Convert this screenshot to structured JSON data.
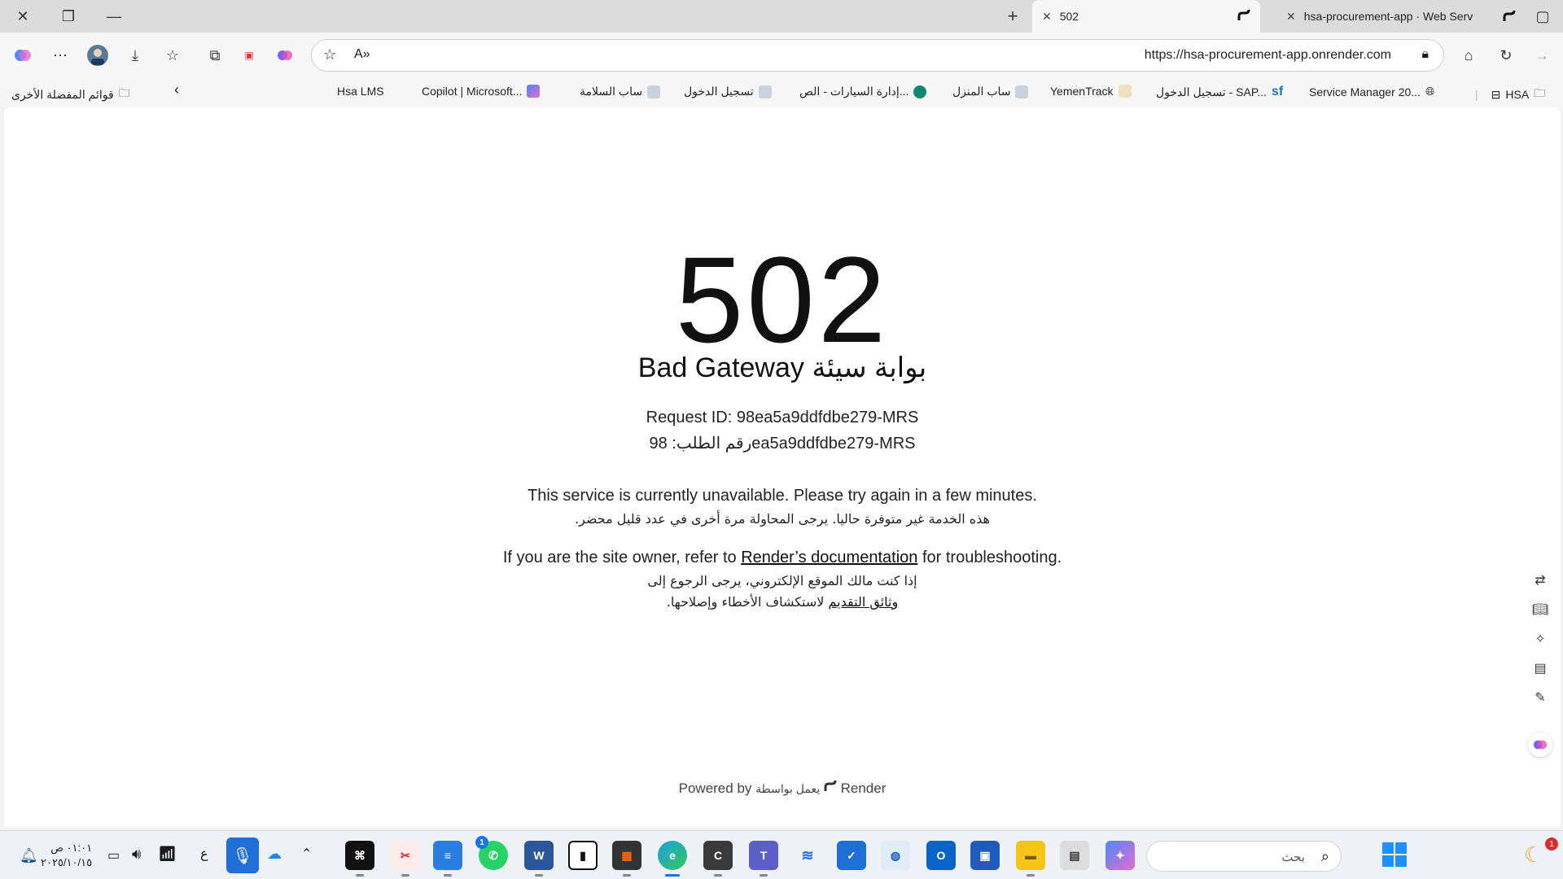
{
  "browser": {
    "tabs": [
      {
        "title": "502",
        "active": true
      },
      {
        "title": "hsa-procurement-app · Web Serv",
        "active": false
      }
    ],
    "new_tab_glyph": "+",
    "url": "https://hsa-procurement-app.onrender.com"
  },
  "bookmarks": {
    "items": [
      {
        "label": "HSA"
      },
      {
        "label": "Service Manager 20..."
      },
      {
        "label": "تسجيل الدخول - SAP..."
      },
      {
        "label": "YemenTrack"
      },
      {
        "label": "ساب المنزل"
      },
      {
        "label": "إدارة السيارات - الص..."
      },
      {
        "label": "تسجيل الدخول"
      },
      {
        "label": "ساب السلامة"
      },
      {
        "label": "Copilot | Microsoft..."
      },
      {
        "label": "Hsa LMS"
      }
    ],
    "other_favorites": "قوائم المفضلة الأخرى"
  },
  "error_page": {
    "code": "502",
    "title_en": "Bad Gateway",
    "title_ar": "بوابة سيئة",
    "request_id_en": "Request ID: 98ea5a9ddfdbe279-MRS",
    "request_id_ar": "رقم الطلب: 98ea5a9ddfdbe279-MRS",
    "unavailable_en": "This service is currently unavailable. Please try again in a few minutes.",
    "unavailable_ar": "هذه الخدمة غير متوفرة حاليا. يرجى المحاولة مرة أخرى في عدد قليل محضر.",
    "owner_en_before": "If you are the site owner, refer to",
    "owner_en_link": "Render’s documentation",
    "owner_en_after": "for troubleshooting.",
    "owner_ar_line1": "إذا كنت مالك الموقع الإلكتروني، يرجى الرجوع إلى",
    "owner_ar_link": "وثائق التقديم",
    "owner_ar_line2_rest": "لاستكشاف الأخطاء وإصلاحها.",
    "powered_by_en": "Powered by",
    "powered_by_ar": "يعمل بواسطة",
    "brand": "Render"
  },
  "taskbar": {
    "search_placeholder": "بحث",
    "time": "٠١:٠١ ص",
    "date": "٢٠٢٥/١٠/١٥",
    "lang_indicator": "ع",
    "whatsapp_badge": "1",
    "notification_badge": "1"
  },
  "colors": {
    "page_bg": "#ffffff",
    "tab_strip": "#dcdcdc",
    "taskbar": "#eef1f6",
    "accent": "#1a73e8"
  }
}
